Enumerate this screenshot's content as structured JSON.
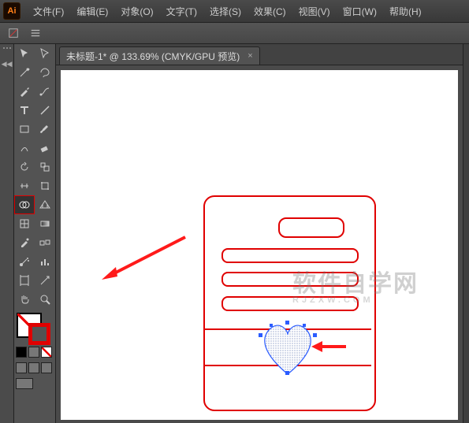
{
  "app": {
    "badge": "Ai"
  },
  "menu": {
    "file": "文件(F)",
    "edit": "编辑(E)",
    "object": "对象(O)",
    "type": "文字(T)",
    "select": "选择(S)",
    "effect": "效果(C)",
    "view": "视图(V)",
    "window": "窗口(W)",
    "help": "帮助(H)"
  },
  "doc_tab": {
    "title": "未标题-1* @ 133.69% (CMYK/GPU 预览)",
    "close": "×"
  },
  "watermark": {
    "main": "软件自学网",
    "sub": "RJZXW.COM"
  },
  "tools": {
    "selection": "selection-tool",
    "direct": "direct-select-tool",
    "magicwand": "magic-wand-tool",
    "lasso": "lasso-tool",
    "pen": "pen-tool",
    "curvature": "curvature-tool",
    "type": "type-tool",
    "line": "line-tool",
    "rect": "rectangle-tool",
    "brush": "paintbrush-tool",
    "shaper": "shaper-tool",
    "eraser": "eraser-tool",
    "rotate": "rotate-tool",
    "scale": "scale-tool",
    "width": "width-tool",
    "freetransform": "free-transform-tool",
    "shapebuilder": "shape-builder-tool",
    "perspective": "perspective-grid-tool",
    "mesh": "mesh-tool",
    "gradient": "gradient-tool",
    "eyedrop": "eyedropper-tool",
    "blend": "blend-tool",
    "symbol": "symbol-sprayer-tool",
    "graph": "column-graph-tool",
    "artboard": "artboard-tool",
    "slice": "slice-tool",
    "hand": "hand-tool",
    "zoom": "zoom-tool"
  }
}
